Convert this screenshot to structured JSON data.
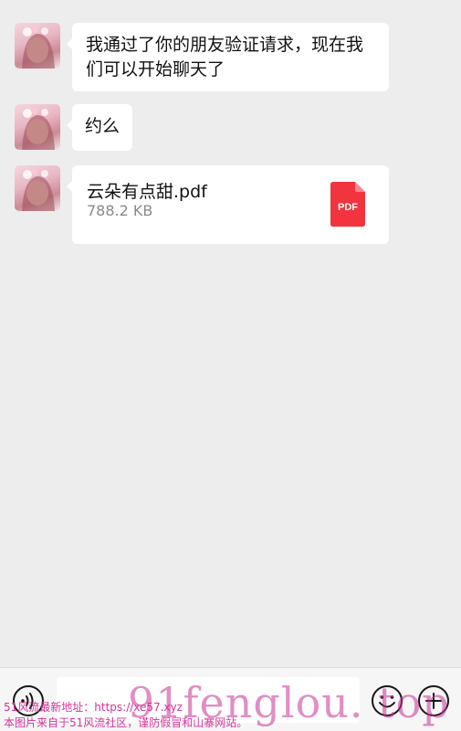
{
  "messages": [
    {
      "text": "我通过了你的朋友验证请求，现在我们可以开始聊天了"
    },
    {
      "text": "约么"
    },
    {
      "file": {
        "name": "云朵有点甜.pdf",
        "size": "788.2 KB",
        "type_label": "PDF",
        "icon_color": "#f2343f"
      }
    }
  ],
  "input_bar": {
    "voice_icon": "voice-icon",
    "emoji_icon": "emoji-icon",
    "plus_icon": "plus-icon",
    "input_value": ""
  },
  "watermark": {
    "big_text": "91fenglou. top",
    "line1": "51风流最新地址：https://xe57.xyz",
    "line2": "本图片来自于51风流社区，谨防假冒和山寨网站。"
  },
  "colors": {
    "background": "#ededed",
    "bubble": "#ffffff",
    "pdf_red": "#f2343f",
    "watermark": "#d6339b"
  }
}
